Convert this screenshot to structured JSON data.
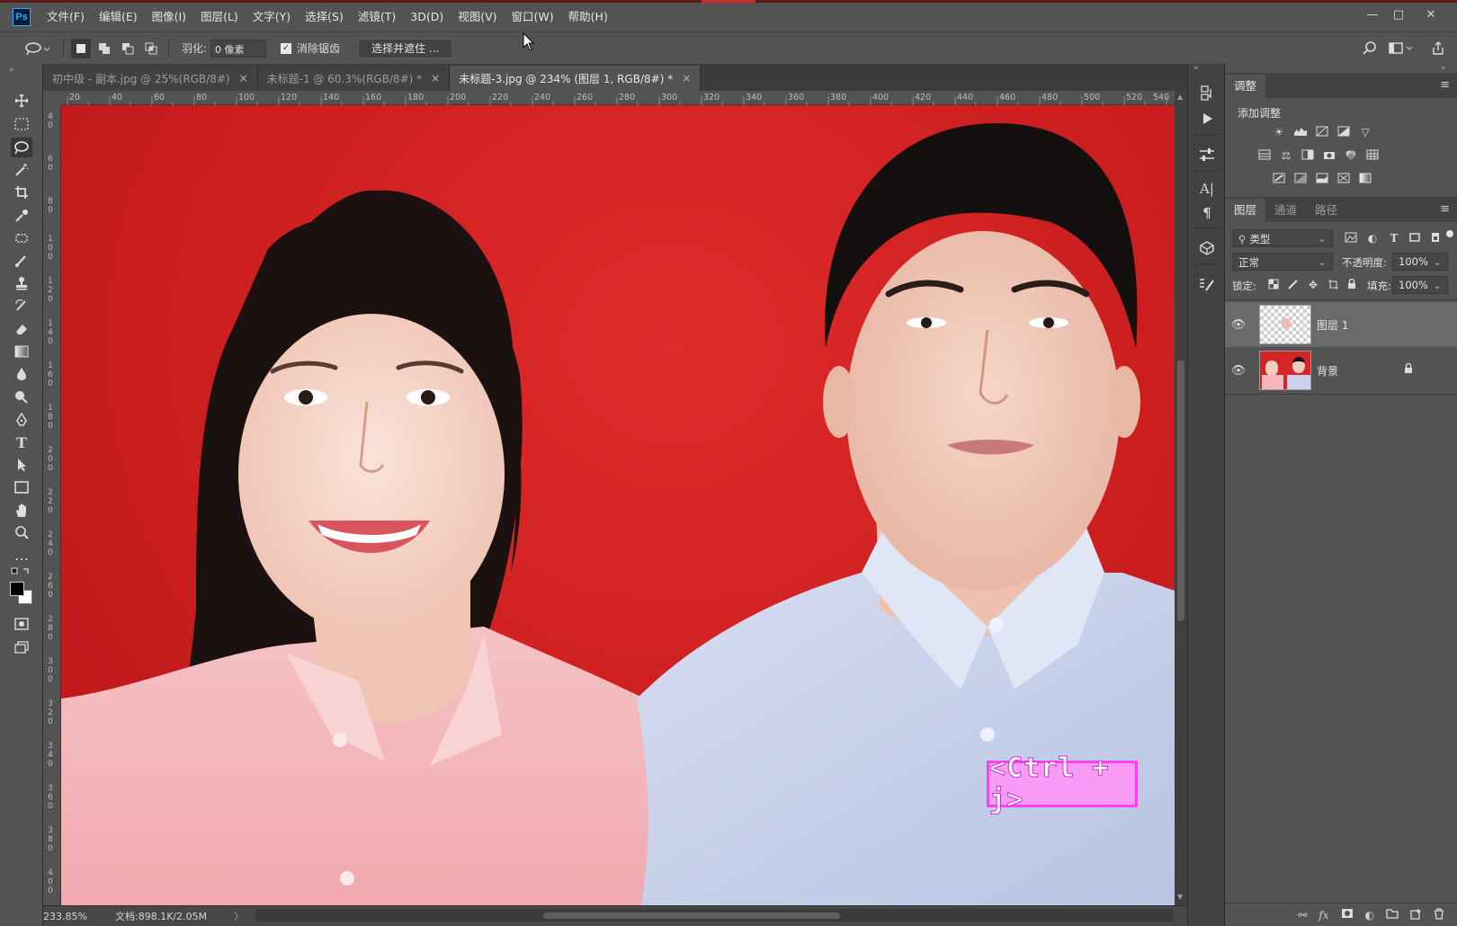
{
  "app": {
    "logo": "Ps"
  },
  "menubar": {
    "items": [
      "文件(F)",
      "编辑(E)",
      "图像(I)",
      "图层(L)",
      "文字(Y)",
      "选择(S)",
      "滤镜(T)",
      "3D(D)",
      "视图(V)",
      "窗口(W)",
      "帮助(H)"
    ],
    "window_controls": [
      "minimize-icon",
      "restore-icon",
      "close-icon"
    ]
  },
  "options": {
    "feather_label": "羽化:",
    "feather_value": "0 像素",
    "antialias_label": "消除锯齿",
    "antialias_checked": true,
    "select_mask_label": "选择并遮住 ..."
  },
  "tabs": [
    {
      "label": "初中级 - 副本.jpg @ 25%(RGB/8#)",
      "close": "×",
      "active": false
    },
    {
      "label": "未标题-1 @ 60.3%(RGB/8#) *",
      "close": "×",
      "active": false
    },
    {
      "label": "未标题-3.jpg @ 234% (图层 1, RGB/8#) *",
      "close": "×",
      "active": true
    }
  ],
  "rulers": {
    "top": [
      "20",
      "40",
      "60",
      "80",
      "100",
      "120",
      "140",
      "160",
      "180",
      "200",
      "220",
      "240",
      "260",
      "280",
      "300",
      "320",
      "340",
      "360",
      "380",
      "400",
      "420",
      "440",
      "460",
      "480",
      "500",
      "520",
      "540"
    ],
    "left": [
      "4\n0",
      "6\n0",
      "8\n0",
      "1\n0\n0",
      "1\n2\n0",
      "1\n4\n0",
      "1\n6\n0",
      "1\n8\n0",
      "2\n0\n0",
      "2\n2\n0",
      "2\n4\n0",
      "2\n6\n0",
      "2\n8\n0",
      "3\n0\n0",
      "3\n2\n0",
      "3\n4\n0",
      "3\n6\n0",
      "3\n8\n0",
      "4\n0\n0"
    ]
  },
  "overlay": {
    "shortcut_label": "<Ctrl + j>"
  },
  "status": {
    "zoom": "233.85%",
    "doc": "文档:898.1K/2.05M",
    "arrow": "〉"
  },
  "adjust_panel": {
    "tab": "调整",
    "add_label": "添加调整"
  },
  "layers_panel": {
    "tabs": [
      "图层",
      "通道",
      "路径"
    ],
    "filter_label": "类型",
    "blend_mode": "正常",
    "opacity_label": "不透明度:",
    "opacity_value": "100%",
    "lock_label": "锁定:",
    "fill_label": "填充:",
    "fill_value": "100%",
    "layers": [
      {
        "name": "图层 1",
        "visible": true,
        "selected": true,
        "locked": false
      },
      {
        "name": "背景",
        "visible": true,
        "selected": false,
        "locked": true
      }
    ]
  },
  "colors": {
    "backdrop_red": "#d42424",
    "shirt_pink": "#f2b8bc",
    "shirt_blue": "#c8d2ec",
    "overlay_magenta": "#ff3ff6",
    "overlay_fill": "#f79bf7"
  }
}
